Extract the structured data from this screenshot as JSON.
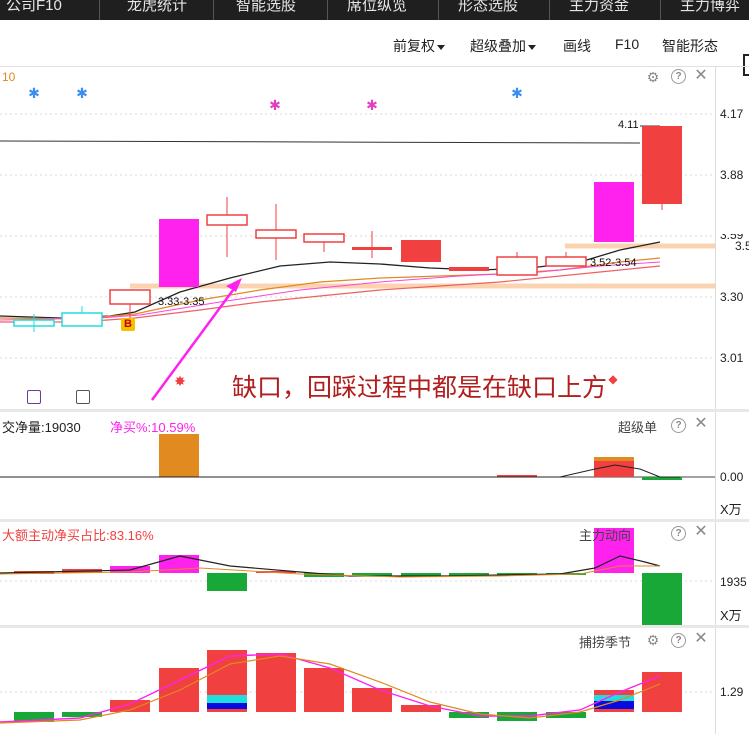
{
  "top_tabs": [
    "公司F10",
    "龙虎统计",
    "智能选股",
    "席位纵览",
    "形态选股",
    "主力资金",
    "主力博弈"
  ],
  "toolbar": {
    "fuquan": "前复权",
    "chaoji": "超级叠加",
    "huaxian": "画线",
    "f10": "F10",
    "zhineng": "智能形态"
  },
  "main_panel": {
    "partial_label": "10",
    "price_axis": [
      "4.17",
      "3.88",
      "3.59",
      "3.30",
      "3.01"
    ],
    "right_edge_label": "3.5",
    "high_tag": "4.11",
    "gap1_label": "3.33-3.35",
    "gap2_label": "3.52-3.54",
    "badge": "B",
    "annotation": "缺口，回踩过程中都是在缺口上方"
  },
  "panel_super": {
    "label_left": "交净量:19030",
    "label_pct": "净买%:10.59%",
    "name": "超级单",
    "axis_value": "0.00",
    "unit": "X万"
  },
  "panel_main_force": {
    "label": "大额主动净买占比:83.16%",
    "name": "主力动向",
    "axis_value": "1935",
    "unit": "X万"
  },
  "panel_season": {
    "name": "捕捞季节",
    "axis_value": "1.29"
  },
  "colors": {
    "up": "#f04040",
    "magenta": "#ff22ee",
    "down_cyan": "#22dddd",
    "green": "#18a838",
    "orange": "#e08a20",
    "annotation": "#b01e1e"
  }
}
